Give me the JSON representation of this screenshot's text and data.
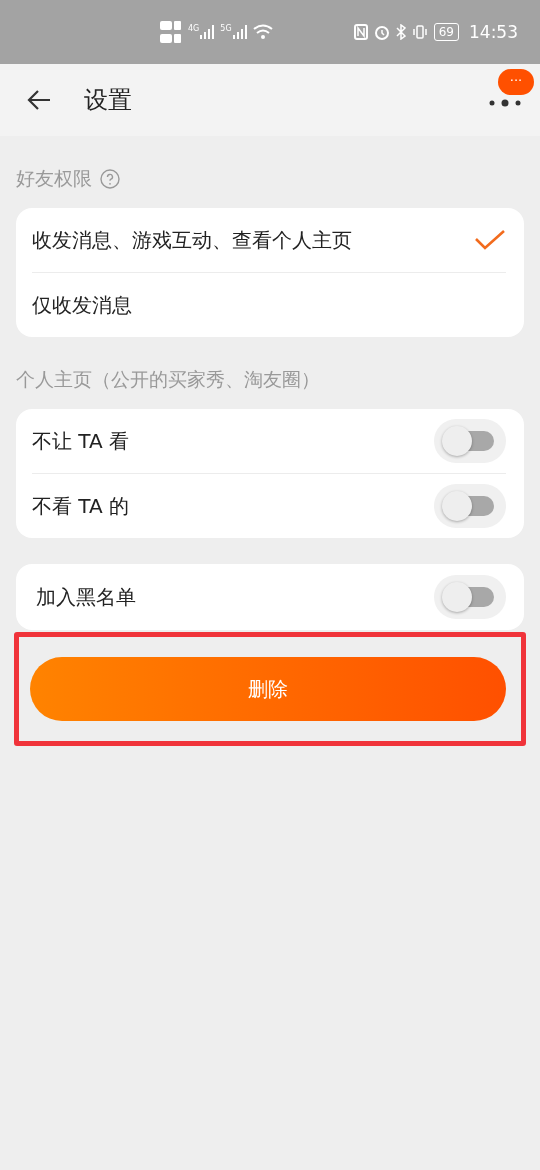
{
  "status_bar": {
    "network_1": "4G",
    "network_2": "5G",
    "battery": "69",
    "time": "14:53"
  },
  "header": {
    "title": "设置",
    "badge": "···"
  },
  "sections": [
    {
      "label": "好友权限",
      "help": true,
      "kind": "radio",
      "items": [
        {
          "label": "收发消息、游戏互动、查看个人主页",
          "selected": true
        },
        {
          "label": "仅收发消息",
          "selected": false
        }
      ]
    },
    {
      "label": "个人主页（公开的买家秀、淘友圈）",
      "help": false,
      "kind": "toggle",
      "items": [
        {
          "label": "不让 TA 看",
          "on": false
        },
        {
          "label": "不看 TA 的",
          "on": false
        }
      ]
    },
    {
      "kind": "toggle",
      "items": [
        {
          "label": "加入黑名单",
          "on": false
        }
      ]
    }
  ],
  "delete_button": {
    "label": "删除",
    "highlighted": true
  }
}
